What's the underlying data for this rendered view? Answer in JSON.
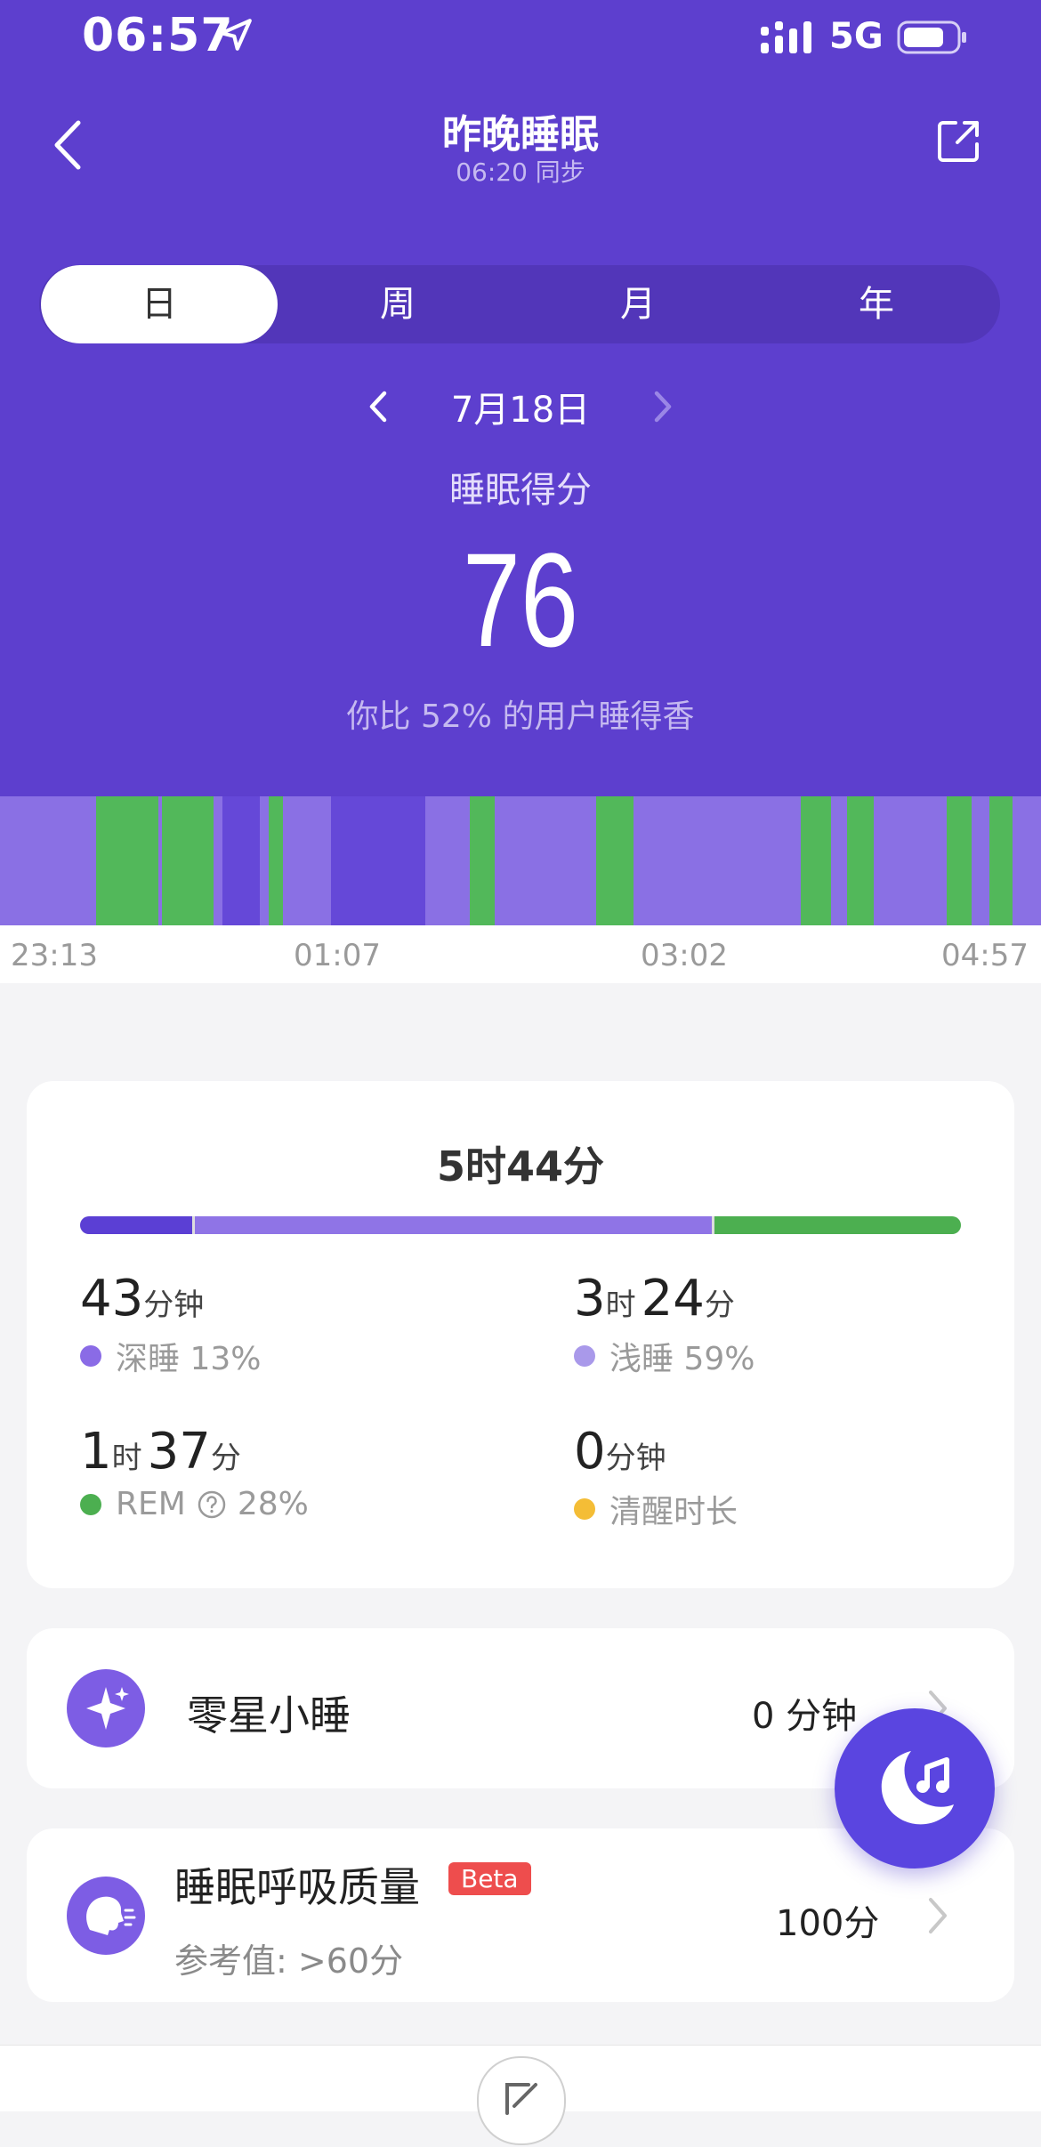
{
  "status_bar": {
    "time": "06:57",
    "network": "5G"
  },
  "nav": {
    "title": "昨晚睡眠",
    "sync_text": "06:20 同步"
  },
  "period_tabs": [
    "日",
    "周",
    "月",
    "年"
  ],
  "active_tab": "日",
  "date": "7月18日",
  "score": {
    "label": "睡眠得分",
    "value": "76",
    "compare": "你比 52% 的用户睡得香"
  },
  "timeline": {
    "labels": [
      "23:13",
      "01:07",
      "03:02",
      "04:57"
    ],
    "colors": {
      "light": "#8a70e4",
      "deep": "#6548d8",
      "rem": "#52b85a"
    }
  },
  "summary": {
    "total": "5时44分",
    "ratios": [
      {
        "name": "深睡",
        "value": 0.13,
        "color": "#5b3fd4"
      },
      {
        "name": "浅睡",
        "value": 0.59,
        "color": "#8f74e6"
      },
      {
        "name": "REM",
        "value": 0.28,
        "color": "#4caf50"
      }
    ],
    "stats": [
      {
        "v1": "43",
        "u1": "分钟",
        "v2": "",
        "u2": "",
        "label": "深睡 13%",
        "color": "#8a6be6"
      },
      {
        "v1": "3",
        "u1": "时",
        "v2": "24",
        "u2": "分",
        "label": "浅睡 59%",
        "color": "#a999ea"
      },
      {
        "v1": "1",
        "u1": "时",
        "v2": "37",
        "u2": "分",
        "label_name": "REM",
        "label_pct": "28%",
        "color": "#4caf50"
      },
      {
        "v1": "0",
        "u1": "分钟",
        "v2": "",
        "u2": "",
        "label": "清醒时长",
        "color": "#f4bd36"
      }
    ]
  },
  "nap": {
    "title": "零星小睡",
    "value": "0 分钟"
  },
  "breathing": {
    "title": "睡眠呼吸质量",
    "badge": "Beta",
    "sub": "参考值: >60分",
    "value": "100分"
  },
  "icons": {
    "back": "chevron-left-icon",
    "share": "share-icon",
    "nap": "sparkle-icon",
    "breathing": "face-breath-icon",
    "fab": "moon-music-icon",
    "help": "question-circle-icon"
  }
}
